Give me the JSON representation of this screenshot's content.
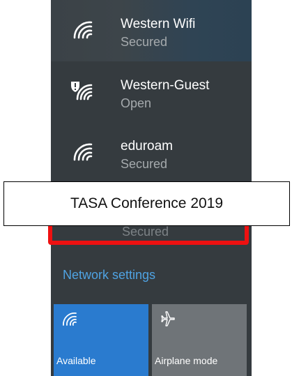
{
  "networks": [
    {
      "name": "Western Wifi",
      "status": "Secured",
      "icon": "wifi-signal-icon"
    },
    {
      "name": "Western-Guest",
      "status": "Open",
      "icon": "wifi-shield-warning-icon"
    },
    {
      "name": "eduroam",
      "status": "Secured",
      "icon": "wifi-signal-icon"
    }
  ],
  "hidden_network": {
    "status": "Secured"
  },
  "callout": {
    "text": "TASA Conference 2019"
  },
  "settings": {
    "label": "Network settings"
  },
  "quick_actions": [
    {
      "label": "Available",
      "icon": "wifi-icon"
    },
    {
      "label": "Airplane mode",
      "icon": "airplane-icon"
    }
  ],
  "colors": {
    "panel_bg": "#353b3f",
    "accent": "#2a7bcf",
    "link": "#4fa3e3",
    "highlight": "#ee1111"
  }
}
